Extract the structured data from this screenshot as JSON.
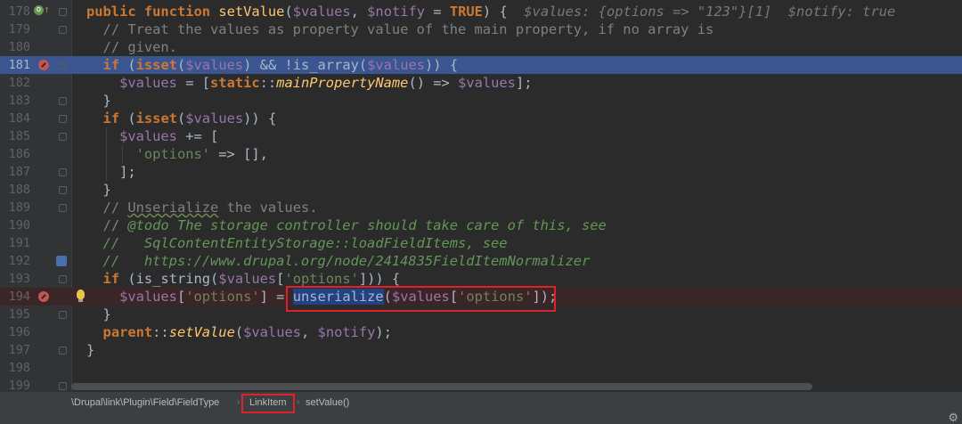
{
  "editor": {
    "lines": [
      {
        "num": "178"
      },
      {
        "num": "179"
      },
      {
        "num": "180"
      },
      {
        "num": "181"
      },
      {
        "num": "182"
      },
      {
        "num": "183"
      },
      {
        "num": "184"
      },
      {
        "num": "185"
      },
      {
        "num": "186"
      },
      {
        "num": "187"
      },
      {
        "num": "188"
      },
      {
        "num": "189"
      },
      {
        "num": "190"
      },
      {
        "num": "191"
      },
      {
        "num": "192"
      },
      {
        "num": "193"
      },
      {
        "num": "194"
      },
      {
        "num": "195"
      },
      {
        "num": "196"
      },
      {
        "num": "197"
      },
      {
        "num": "198"
      },
      {
        "num": "199"
      }
    ],
    "debug_hint": "$values: {options => \"123\"}[1]  $notify: true",
    "t": {
      "public": "public",
      "function": "function",
      "setValue": "setValue",
      "values": "$values",
      "notify": "$notify",
      "TRUE": "TRUE",
      "comma_sp": ", ",
      "eq_sp": " = ",
      "open_paren": "(",
      "close_open_brace": ") {",
      "c179": "// Treat the values as property value of the main property, if no array is",
      "c180": "// given.",
      "if": "if",
      "isset": "isset",
      "open": " (",
      "is_array_pre": ") && !is_array(",
      "close2_brace": ")) {",
      "l182_eq": " = [",
      "static": "static",
      "dcolon": "::",
      "mainPropertyName": "mainPropertyName",
      "l182_arrow": "() => ",
      "l182_end": "];",
      "brace_close": "}",
      "l185_op": " += [",
      "options_q": "'options'",
      "l186_end": " => [],",
      "l187": "];",
      "c189_pre": "// ",
      "c189_word": "Unserialize",
      "c189_post": " the values.",
      "c190_pre": "// ",
      "c190_tag": "@todo",
      "c190_post": " The storage controller should take care of this, see",
      "c191": "//   SqlContentEntityStorage::loadFieldItems, see",
      "c192": "//   https://www.drupal.org/node/2414835FieldItemNormalizer",
      "is_string_pre": " (is_string(",
      "bracket_open": "[",
      "bracket_close_close": "])) {",
      "l194_mid": "] = ",
      "unserialize": "unserialize",
      "l194_end": "]);",
      "parent": "parent",
      "setValue_call_end": ");"
    }
  },
  "breadcrumb": {
    "namespace": "\\Drupal\\link\\Plugin\\Field\\FieldType",
    "class": "LinkItem",
    "method": "setValue()",
    "separator": "›"
  },
  "icons": {
    "breakpoint": "breakpoint-icon",
    "override": "override-method-icon",
    "bulb": "intention-bulb-icon",
    "settings": "gear-icon"
  },
  "colors": {
    "background": "#2b2b2b",
    "keyword": "#cc7832",
    "function": "#ffc66d",
    "variable": "#9876aa",
    "string": "#6a8759",
    "comment": "#808080",
    "execution_line": "#3a5590",
    "highlight_box": "#e0202a"
  }
}
